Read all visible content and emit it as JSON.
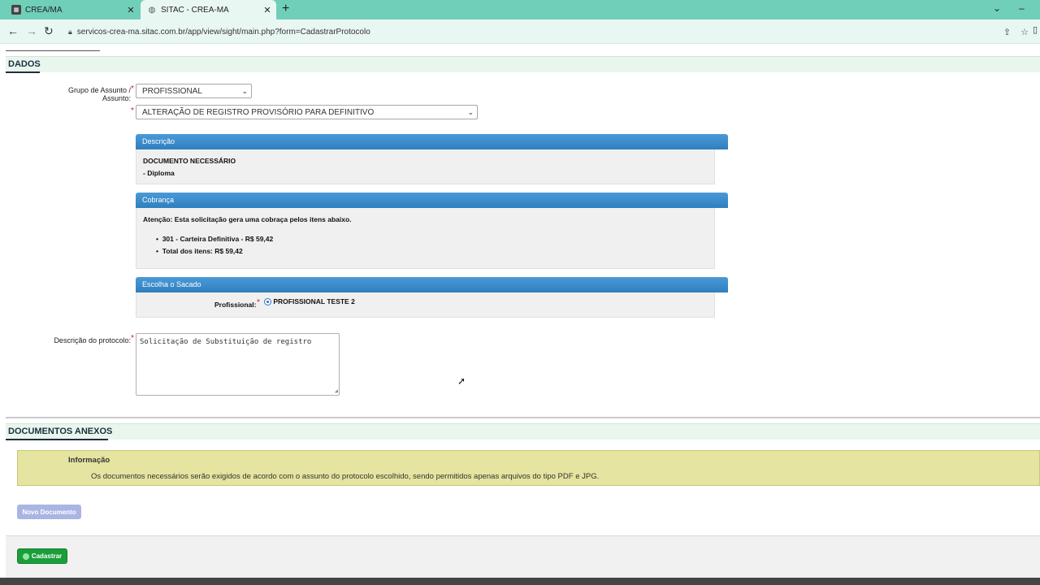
{
  "browser": {
    "tabs": [
      {
        "title": "CREA/MA",
        "icon": "crea-favicon"
      },
      {
        "title": "SITAC - CREA-MA",
        "icon": "globe-icon"
      }
    ],
    "url": "servicos-crea-ma.sitac.com.br/app/view/sight/main.php?form=CadastrarProtocolo"
  },
  "dados": {
    "section_title": "DADOS",
    "grupo_label": "Grupo de Assunto / Assunto:",
    "grupo_value": "PROFISSIONAL",
    "assunto_value": "ALTERAÇÃO DE REGISTRO PROVISÓRIO PARA DEFINITIVO",
    "descricao_box": {
      "title": "Descrição",
      "heading": "DOCUMENTO NECESSÁRIO",
      "item": "- Diploma"
    },
    "cobranca_box": {
      "title": "Cobrança",
      "notice": "Atenção: Esta solicitação gera uma cobraça pelos itens abaixo.",
      "items": [
        "301 - Carteira Definitiva - R$ 59,42",
        "Total dos itens: R$ 59,42"
      ]
    },
    "sacado_box": {
      "title": "Escolha o Sacado",
      "label": "Profissional:",
      "option": "PROFISSIONAL TESTE 2"
    },
    "protocolo_label": "Descrição do protocolo:",
    "protocolo_value": "Solicitação de Substituição de registro"
  },
  "anexos": {
    "section_title": "DOCUMENTOS ANEXOS",
    "info_title": "Informação",
    "info_text": "Os documentos necessários serão exigidos de acordo com o assunto do protocolo escolhido, sendo permitidos apenas arquivos do tipo PDF e JPG.",
    "novo_button": "Novo Documento"
  },
  "footer": {
    "cadastrar_button": "Cadastrar"
  }
}
